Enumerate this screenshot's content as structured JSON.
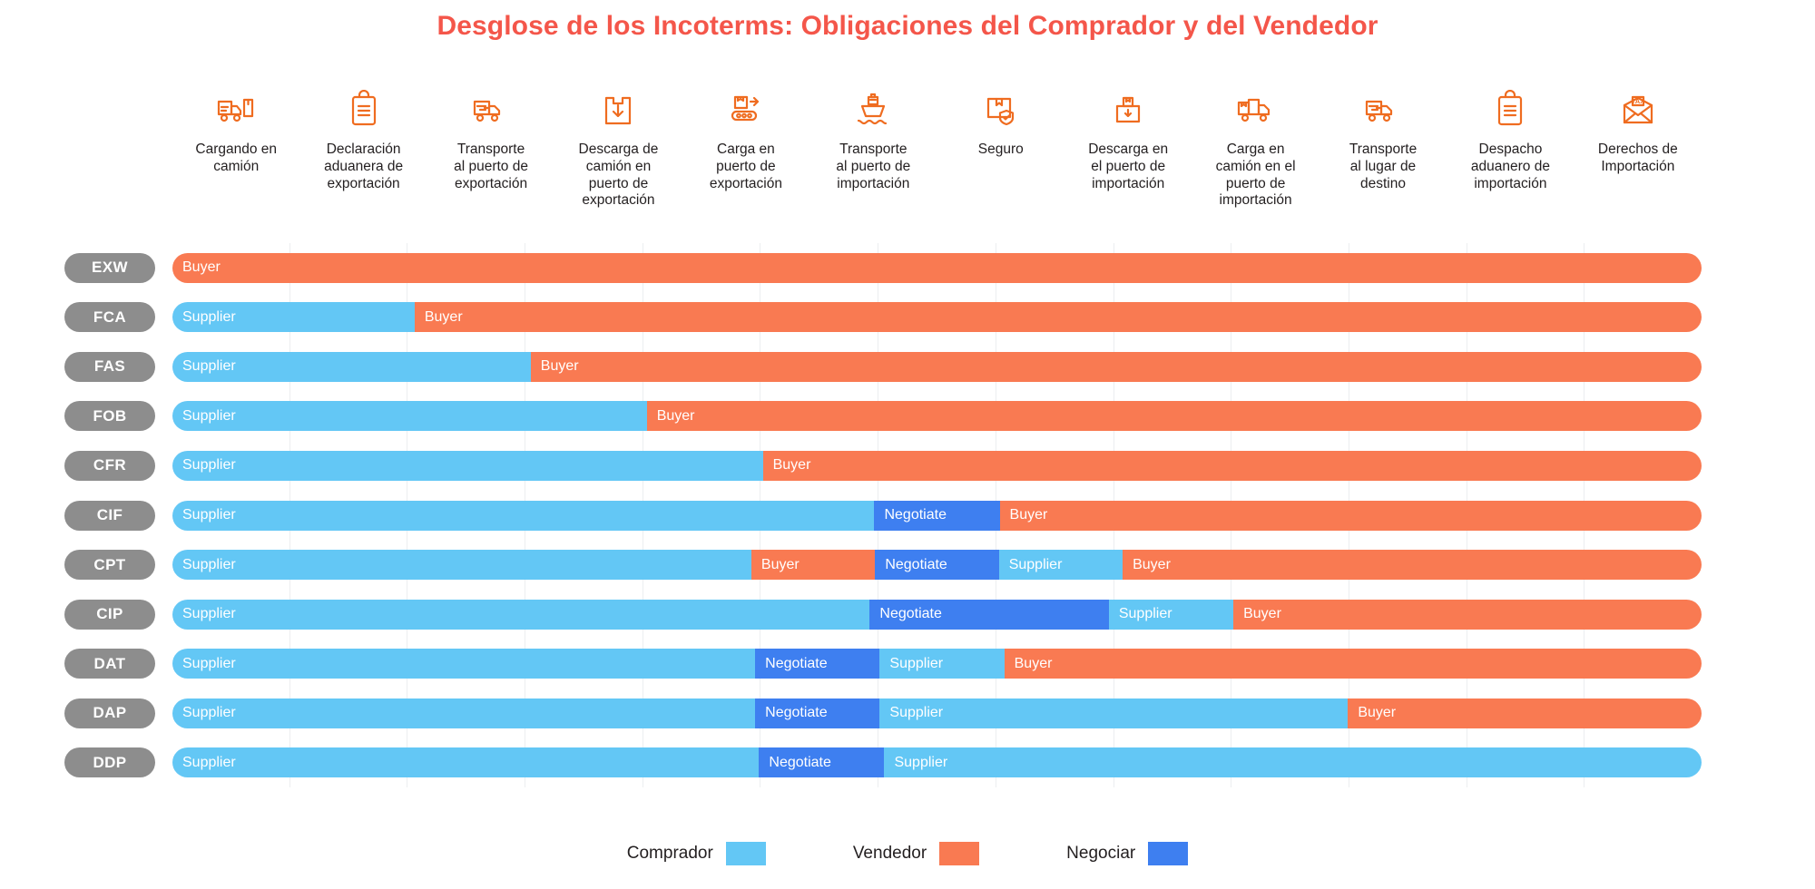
{
  "title": "Desglose de los Incoterms: Obligaciones del Comprador y del Vendedor",
  "colors": {
    "buyer": "#63c7f5",
    "seller": "#f97a52",
    "negotiate": "#3e7ff0",
    "title": "#f4564a",
    "pill": "#8d8d8d",
    "gridline": "#eceef0"
  },
  "columns": [
    {
      "label": "Cargando en\ncamión",
      "icon": "truck-loading-icon"
    },
    {
      "label": "Declaración\naduanera de\nexportación",
      "icon": "clipboard-document-icon"
    },
    {
      "label": "Transporte\nal puerto de\nexportación",
      "icon": "truck-transport-icon"
    },
    {
      "label": "Descarga de\ncamión en\npuerto de\nexportación",
      "icon": "box-unload-down-icon"
    },
    {
      "label": "Carga en\npuerto de\nexportación",
      "icon": "conveyor-load-icon"
    },
    {
      "label": "Transporte\nal puerto de\nimportación",
      "icon": "ship-icon"
    },
    {
      "label": "Seguro",
      "icon": "box-shield-insurance-icon"
    },
    {
      "label": "Descarga en\nel puerto de\nimportación",
      "icon": "crate-unload-icon"
    },
    {
      "label": "Carga en\ncamión en el\npuerto de\nimportación",
      "icon": "truck-cargo-load-icon"
    },
    {
      "label": "Transporte\nal lugar de\ndestino",
      "icon": "truck-transport-icon"
    },
    {
      "label": "Despacho\naduanero de\nimportación",
      "icon": "clipboard-document-icon"
    },
    {
      "label": "Derechos de\nImportación",
      "icon": "tax-envelope-icon"
    }
  ],
  "legend": [
    {
      "label": "Comprador",
      "swatch": "buyer"
    },
    {
      "label": "Vendedor",
      "swatch": "seller"
    },
    {
      "label": "Negociar",
      "swatch": "negotiate"
    }
  ],
  "labels": {
    "buyer": "Buyer",
    "supplier": "Supplier",
    "negotiate": "Negotiate"
  },
  "chart_data": {
    "type": "bar",
    "title": "Desglose de los Incoterms: Obligaciones del Comprador y del Vendedor",
    "xlabel": "",
    "ylabel": "",
    "legend_position": "bottom",
    "grid": true,
    "columns_count": 13,
    "categories": [
      "Cargando en camión",
      "Declaración aduanera de exportación",
      "Transporte al puerto de exportación",
      "Descarga de camión en puerto de exportación",
      "Carga en puerto de exportación",
      "Transporte al puerto de importación",
      "Seguro",
      "Descarga en el puerto de importación",
      "Carga en camión en el puerto de importación",
      "Transporte al lugar de destino",
      "Despacho aduanero de importación",
      "Derechos de Importación"
    ],
    "rows": [
      {
        "code": "EXW",
        "segments": [
          {
            "label": "Buyer",
            "party": "buyer",
            "span": 13,
            "start": 1,
            "end": 13
          }
        ]
      },
      {
        "code": "FCA",
        "segments": [
          {
            "label": "Supplier",
            "party": "supplier",
            "span": 2,
            "start": 1,
            "end": 2
          },
          {
            "label": "Buyer",
            "party": "buyer",
            "span": 11,
            "start": 3,
            "end": 13
          }
        ]
      },
      {
        "code": "FAS",
        "segments": [
          {
            "label": "Supplier",
            "party": "supplier",
            "span": 3,
            "start": 1,
            "end": 3
          },
          {
            "label": "Buyer",
            "party": "buyer",
            "span": 10,
            "start": 4,
            "end": 13
          }
        ]
      },
      {
        "code": "FOB",
        "segments": [
          {
            "label": "Supplier",
            "party": "supplier",
            "span": 4,
            "start": 1,
            "end": 4
          },
          {
            "label": "Buyer",
            "party": "buyer",
            "span": 9,
            "start": 5,
            "end": 13
          }
        ]
      },
      {
        "code": "CFR",
        "segments": [
          {
            "label": "Supplier",
            "party": "supplier",
            "span": 5,
            "start": 1,
            "end": 5
          },
          {
            "label": "Buyer",
            "party": "buyer",
            "span": 8,
            "start": 6,
            "end": 13
          }
        ]
      },
      {
        "code": "CIF",
        "segments": [
          {
            "label": "Supplier",
            "party": "supplier",
            "span": 6,
            "start": 1,
            "end": 6
          },
          {
            "label": "Negotiate",
            "party": "negotiate",
            "span": 1,
            "start": 7,
            "end": 7
          },
          {
            "label": "Buyer",
            "party": "buyer",
            "span": 6,
            "start": 8,
            "end": 13
          }
        ]
      },
      {
        "code": "CPT",
        "segments": [
          {
            "label": "Supplier",
            "party": "supplier",
            "span": 5,
            "start": 1,
            "end": 5
          },
          {
            "label": "Buyer",
            "party": "buyer",
            "span": 1,
            "start": 6,
            "end": 6
          },
          {
            "label": "Negotiate",
            "party": "negotiate",
            "span": 1,
            "start": 7,
            "end": 7
          },
          {
            "label": "Supplier",
            "party": "supplier",
            "span": 1,
            "start": 8,
            "end": 8
          },
          {
            "label": "Buyer",
            "party": "buyer",
            "span": 5,
            "start": 9,
            "end": 13
          }
        ]
      },
      {
        "code": "CIP",
        "segments": [
          {
            "label": "Supplier",
            "party": "supplier",
            "span": 6,
            "start": 1,
            "end": 6
          },
          {
            "label": "Negotiate",
            "party": "negotiate",
            "span": 2,
            "start": 7,
            "end": 8
          },
          {
            "label": "Supplier",
            "party": "supplier",
            "span": 1,
            "start": 9,
            "end": 9
          },
          {
            "label": "Buyer",
            "party": "buyer",
            "span": 4,
            "start": 10,
            "end": 13
          }
        ]
      },
      {
        "code": "DAT",
        "segments": [
          {
            "label": "Supplier",
            "party": "supplier",
            "span": 5,
            "start": 1,
            "end": 5
          },
          {
            "label": "Negotiate",
            "party": "negotiate",
            "span": 1,
            "start": 6,
            "end": 6
          },
          {
            "label": "Supplier",
            "party": "supplier",
            "span": 1,
            "start": 7,
            "end": 7
          },
          {
            "label": "Buyer",
            "party": "buyer",
            "span": 6,
            "start": 8,
            "end": 13
          }
        ]
      },
      {
        "code": "DAP",
        "segments": [
          {
            "label": "Supplier",
            "party": "supplier",
            "span": 5,
            "start": 1,
            "end": 5
          },
          {
            "label": "Negotiate",
            "party": "negotiate",
            "span": 1,
            "start": 6,
            "end": 6
          },
          {
            "label": "Supplier",
            "party": "supplier",
            "span": 4,
            "start": 7,
            "end": 10
          },
          {
            "label": "Buyer",
            "party": "buyer",
            "span": 3,
            "start": 11,
            "end": 13
          }
        ]
      },
      {
        "code": "DDP",
        "segments": [
          {
            "label": "Supplier",
            "party": "supplier",
            "span": 5,
            "start": 1,
            "end": 5
          },
          {
            "label": "Negotiate",
            "party": "negotiate",
            "span": 1,
            "start": 6,
            "end": 6
          },
          {
            "label": "Supplier",
            "party": "supplier",
            "span": 7,
            "start": 7,
            "end": 13
          }
        ]
      }
    ]
  }
}
